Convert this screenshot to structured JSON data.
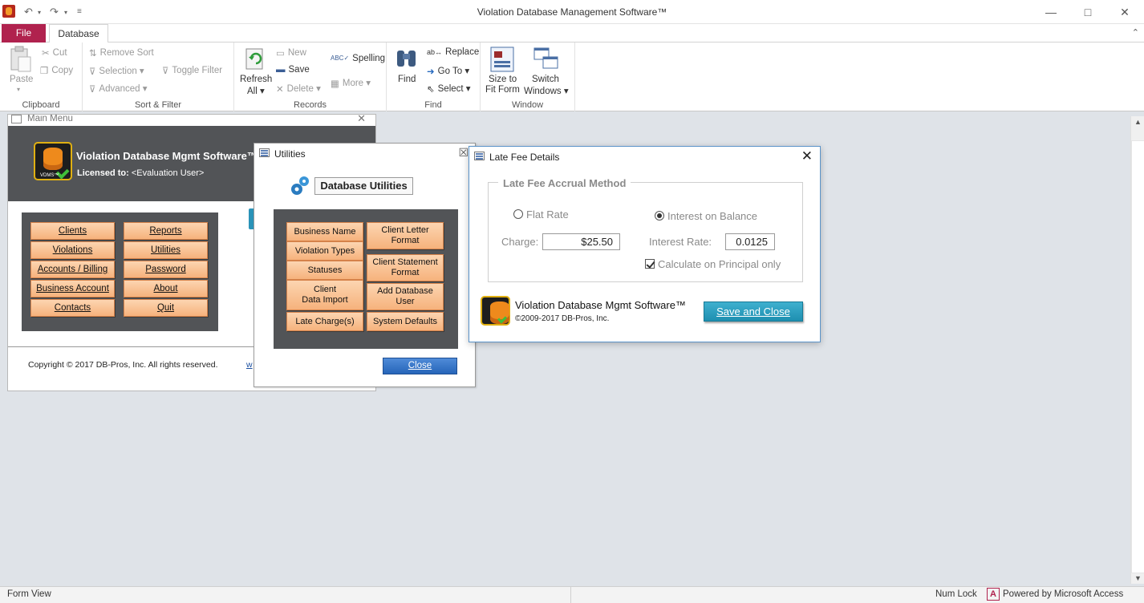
{
  "window": {
    "title": "Violation Database Management Software™",
    "controls": [
      "minimize-icon",
      "maximize-icon",
      "close-icon"
    ]
  },
  "ribbon": {
    "tabs": {
      "file": "File",
      "database": "Database"
    },
    "clipboard": {
      "paste": "Paste",
      "cut": "Cut",
      "copy": "Copy",
      "label": "Clipboard"
    },
    "sort_filter": {
      "remove_sort": "Remove Sort",
      "selection": "Selection",
      "advanced": "Advanced",
      "toggle_filter": "Toggle Filter",
      "label": "Sort & Filter"
    },
    "records": {
      "refresh_1": "Refresh",
      "refresh_2": "All",
      "new": "New",
      "save": "Save",
      "delete": "Delete",
      "spelling": "Spelling",
      "more": "More",
      "label": "Records"
    },
    "find": {
      "find": "Find",
      "replace": "Replace",
      "go_to": "Go To",
      "select": "Select",
      "label": "Find"
    },
    "window": {
      "size_1": "Size to",
      "size_2": "Fit Form",
      "switch_1": "Switch",
      "switch_2": "Windows",
      "label": "Window"
    }
  },
  "main_menu": {
    "title": "Main Menu",
    "app_name": "Violation Database Mgmt Software™",
    "licensed_label": "Licensed to:",
    "licensed_value": "<Evaluation User>",
    "buttons": [
      "Clients",
      "Reports",
      "Violations",
      "Utilities",
      "Accounts / Billing",
      "Password",
      "Business Account",
      "About",
      "Contacts",
      "Quit"
    ],
    "copyright": "Copyright © 2017 DB-Pros, Inc.  All rights reserved.",
    "link_stub": "w"
  },
  "utilities": {
    "title": "Utilities",
    "heading": "Database Utilities",
    "buttons": [
      "Business Name",
      "Client Letter\nFormat",
      "Violation Types",
      "Client Statement\nFormat",
      "Statuses",
      "Client\nData Import",
      "Add Database\nUser",
      "Late Charge(s)",
      "System Defaults"
    ],
    "close": "Close"
  },
  "late_fee": {
    "title": "Late Fee Details",
    "group_label": "Late Fee Accrual Method",
    "radio_flat": "Flat Rate",
    "radio_interest": "Interest on Balance",
    "selected": "Interest on Balance",
    "charge_label": "Charge:",
    "charge_value": "$25.50",
    "interest_label": "Interest Rate:",
    "interest_value": "0.0125",
    "principal_label": "Calculate on Principal only",
    "principal_checked": true,
    "app_name": "Violation Database Mgmt Software™",
    "copyright": "©2009-2017 DB-Pros, Inc.",
    "save_close": "Save and Close"
  },
  "status": {
    "view": "Form View",
    "num_lock": "Num Lock",
    "powered": "Powered by Microsoft Access"
  },
  "colors": {
    "file_tab": "#b0224e",
    "panel_dark": "#525457",
    "orange_button": "#f6b27c",
    "close_button_blue": "#2665b9",
    "save_button_teal": "#1e8fb0",
    "logo_border": "#e0b012"
  }
}
